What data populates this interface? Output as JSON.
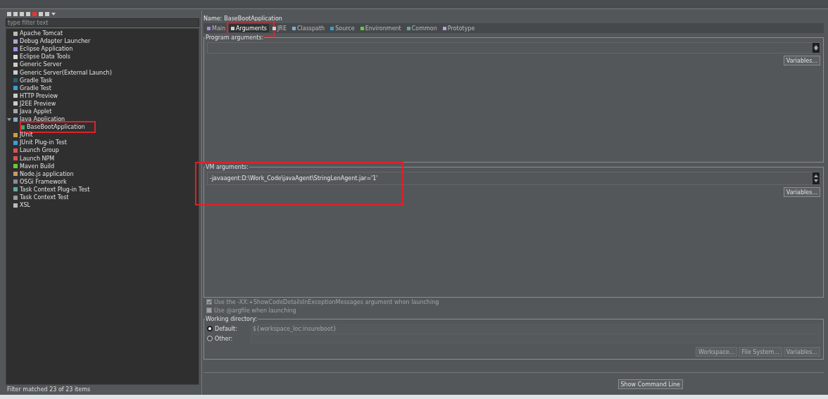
{
  "sidebar": {
    "filter": {
      "placeholder": "type filter text"
    },
    "tree": [
      {
        "label": "Apache Tomcat"
      },
      {
        "label": "Debug Adapter Launcher"
      },
      {
        "label": "Eclipse Application"
      },
      {
        "label": "Eclipse Data Tools"
      },
      {
        "label": "Generic Server"
      },
      {
        "label": "Generic Server(External Launch)"
      },
      {
        "label": "Gradle Task"
      },
      {
        "label": "Gradle Test"
      },
      {
        "label": "HTTP Preview"
      },
      {
        "label": "J2EE Preview"
      },
      {
        "label": "Java Applet"
      },
      {
        "label": "Java Application",
        "expanded": true,
        "children": [
          {
            "label": "BaseBootApplication",
            "highlighted": true
          }
        ]
      },
      {
        "label": "JUnit"
      },
      {
        "label": "JUnit Plug-in Test"
      },
      {
        "label": "Launch Group"
      },
      {
        "label": "Launch NPM"
      },
      {
        "label": "Maven Build"
      },
      {
        "label": "Node.js application"
      },
      {
        "label": "OSGi Framework"
      },
      {
        "label": "Task Context Plug-in Test"
      },
      {
        "label": "Task Context Test"
      },
      {
        "label": "XSL"
      }
    ],
    "status": "Filter matched 23 of 23 items"
  },
  "editor": {
    "name_label": "Name:",
    "name_value": "BaseBootApplication",
    "tabs": [
      {
        "label": "Main",
        "selected": false,
        "highlighted": false
      },
      {
        "label": "Arguments",
        "selected": true,
        "highlighted": true
      },
      {
        "label": "JRE",
        "selected": false,
        "highlighted": false
      },
      {
        "label": "Classpath",
        "selected": false,
        "highlighted": false
      },
      {
        "label": "Source",
        "selected": false,
        "highlighted": false
      },
      {
        "label": "Environment",
        "selected": false,
        "highlighted": false
      },
      {
        "label": "Common",
        "selected": false,
        "highlighted": false
      },
      {
        "label": "Prototype",
        "selected": false,
        "highlighted": false
      }
    ],
    "program_arguments": {
      "title": "Program arguments:",
      "button": "Variables..."
    },
    "vm_arguments": {
      "title": "VM arguments:",
      "value": "-javaagent:D:\\Work_Code\\javaAgent\\StringLenAgent.jar='1'",
      "button": "Variables...",
      "highlighted": true
    },
    "options": [
      {
        "label": "Use the -XX:+ShowCodeDetailsInExceptionMessages argument when launching",
        "checked": true,
        "disabled": true
      },
      {
        "label": "Use @argfile when launching",
        "checked": false,
        "disabled": true
      }
    ],
    "working_directory": {
      "title": "Working directory:",
      "choices": [
        {
          "label": "Default:",
          "selected": true,
          "value": "${workspace_loc:insureboot}"
        },
        {
          "label": "Other:",
          "selected": false
        }
      ],
      "buttons": [
        "Workspace...",
        "File System...",
        "Variables..."
      ]
    },
    "bottom_button": "Show Command Line"
  }
}
